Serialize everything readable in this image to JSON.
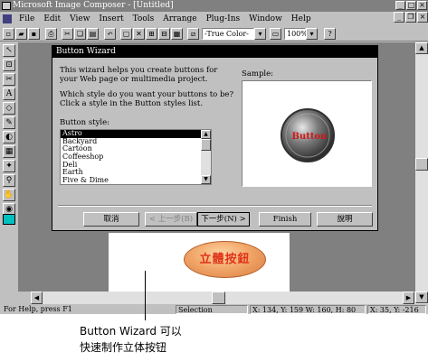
{
  "app": {
    "title": "Microsoft Image Composer - [Untitled]",
    "menus": [
      "File",
      "Edit",
      "View",
      "Insert",
      "Tools",
      "Arrange",
      "Plug-Ins",
      "Window",
      "Help"
    ]
  },
  "toolbar": {
    "color_mode": "-True Color-",
    "zoom": "100%"
  },
  "wizard": {
    "title": "Button Wizard",
    "intro": "This wizard helps you create buttons for your Web page or multimedia project.",
    "question": "Which style do you want your buttons to be?  Click a style in the Button styles list.",
    "style_label": "Button style:",
    "styles": [
      "Astro",
      "Backyard",
      "Cartoon",
      "Coffeeshop",
      "Deli",
      "Earth",
      "Five & Dime"
    ],
    "selected_style": "Astro",
    "sample_label": "Sample:",
    "sample_text": "Button",
    "buttons": {
      "cancel": "取消",
      "back": "< 上一步(B)",
      "next": "下一步(N) >",
      "finish": "Finish",
      "help": "說明"
    }
  },
  "canvas": {
    "button_text": "立體按鈕"
  },
  "status": {
    "help": "For Help, press F1",
    "mode": "Selection",
    "geometry": "X: 134, Y: 159  W: 160, H: 80",
    "cursor": "X: 35, Y: -216"
  },
  "caption": {
    "line1": "Button Wizard 可以",
    "line2": "快速制作立体按钮"
  }
}
